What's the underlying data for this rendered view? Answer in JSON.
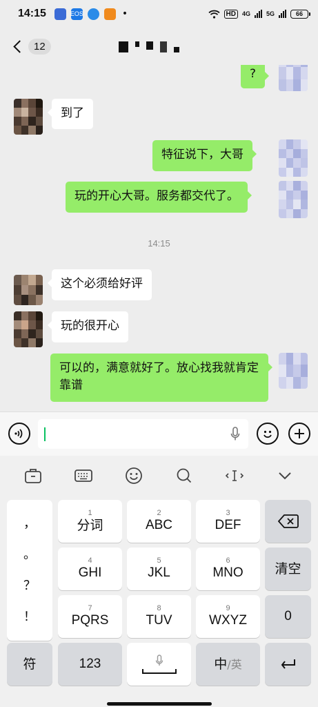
{
  "status": {
    "time": "14:15",
    "hd": "HD",
    "net1": "4G",
    "net2": "5G",
    "battery": "66",
    "dot": "•",
    "notif_colors": [
      "#3b6bd6",
      "#1d79e6",
      "#2a8be8",
      "#f08a1d"
    ],
    "notif_labels": [
      "",
      "EOS",
      "",
      ""
    ]
  },
  "header": {
    "unread_count": "12"
  },
  "chat": {
    "messages": [
      {
        "from": "me",
        "text": "?"
      },
      {
        "from": "them",
        "text": "到了"
      },
      {
        "from": "me",
        "text": "特征说下，大哥"
      },
      {
        "from": "me",
        "text": "玩的开心大哥。服务都交代了。"
      },
      {
        "from": "them",
        "text": "这个必须给好评"
      },
      {
        "from": "them",
        "text": "玩的很开心"
      },
      {
        "from": "me",
        "text": "可以的，满意就好了。放心找我就肯定靠谱"
      }
    ],
    "time_separator": "14:15",
    "colors": {
      "my_bubble": "#95ec69",
      "their_bubble": "#ffffff"
    }
  },
  "input": {
    "value": "",
    "voice_icon": "voice-icon",
    "emoji_icon": "emoji-icon",
    "plus_icon": "plus-icon"
  },
  "toolbar": {
    "icons": [
      "briefcase-icon",
      "keyboard-icon",
      "emoji-icon",
      "search-icon",
      "cursor-icon",
      "chevron-down-icon"
    ]
  },
  "keyboard": {
    "punctuation": [
      "，",
      "。",
      "？",
      "！"
    ],
    "keys": [
      {
        "num": "1",
        "label": "分词"
      },
      {
        "num": "2",
        "label": "ABC"
      },
      {
        "num": "3",
        "label": "DEF"
      },
      {
        "num": "4",
        "label": "GHI"
      },
      {
        "num": "5",
        "label": "JKL"
      },
      {
        "num": "6",
        "label": "MNO"
      },
      {
        "num": "7",
        "label": "PQRS"
      },
      {
        "num": "8",
        "label": "TUV"
      },
      {
        "num": "9",
        "label": "WXYZ"
      }
    ],
    "clear_label": "清空",
    "zero_label": "0",
    "symbol_label": "符",
    "numbers_label": "123",
    "lang_label_cn": "中",
    "lang_label_en": "/英"
  }
}
